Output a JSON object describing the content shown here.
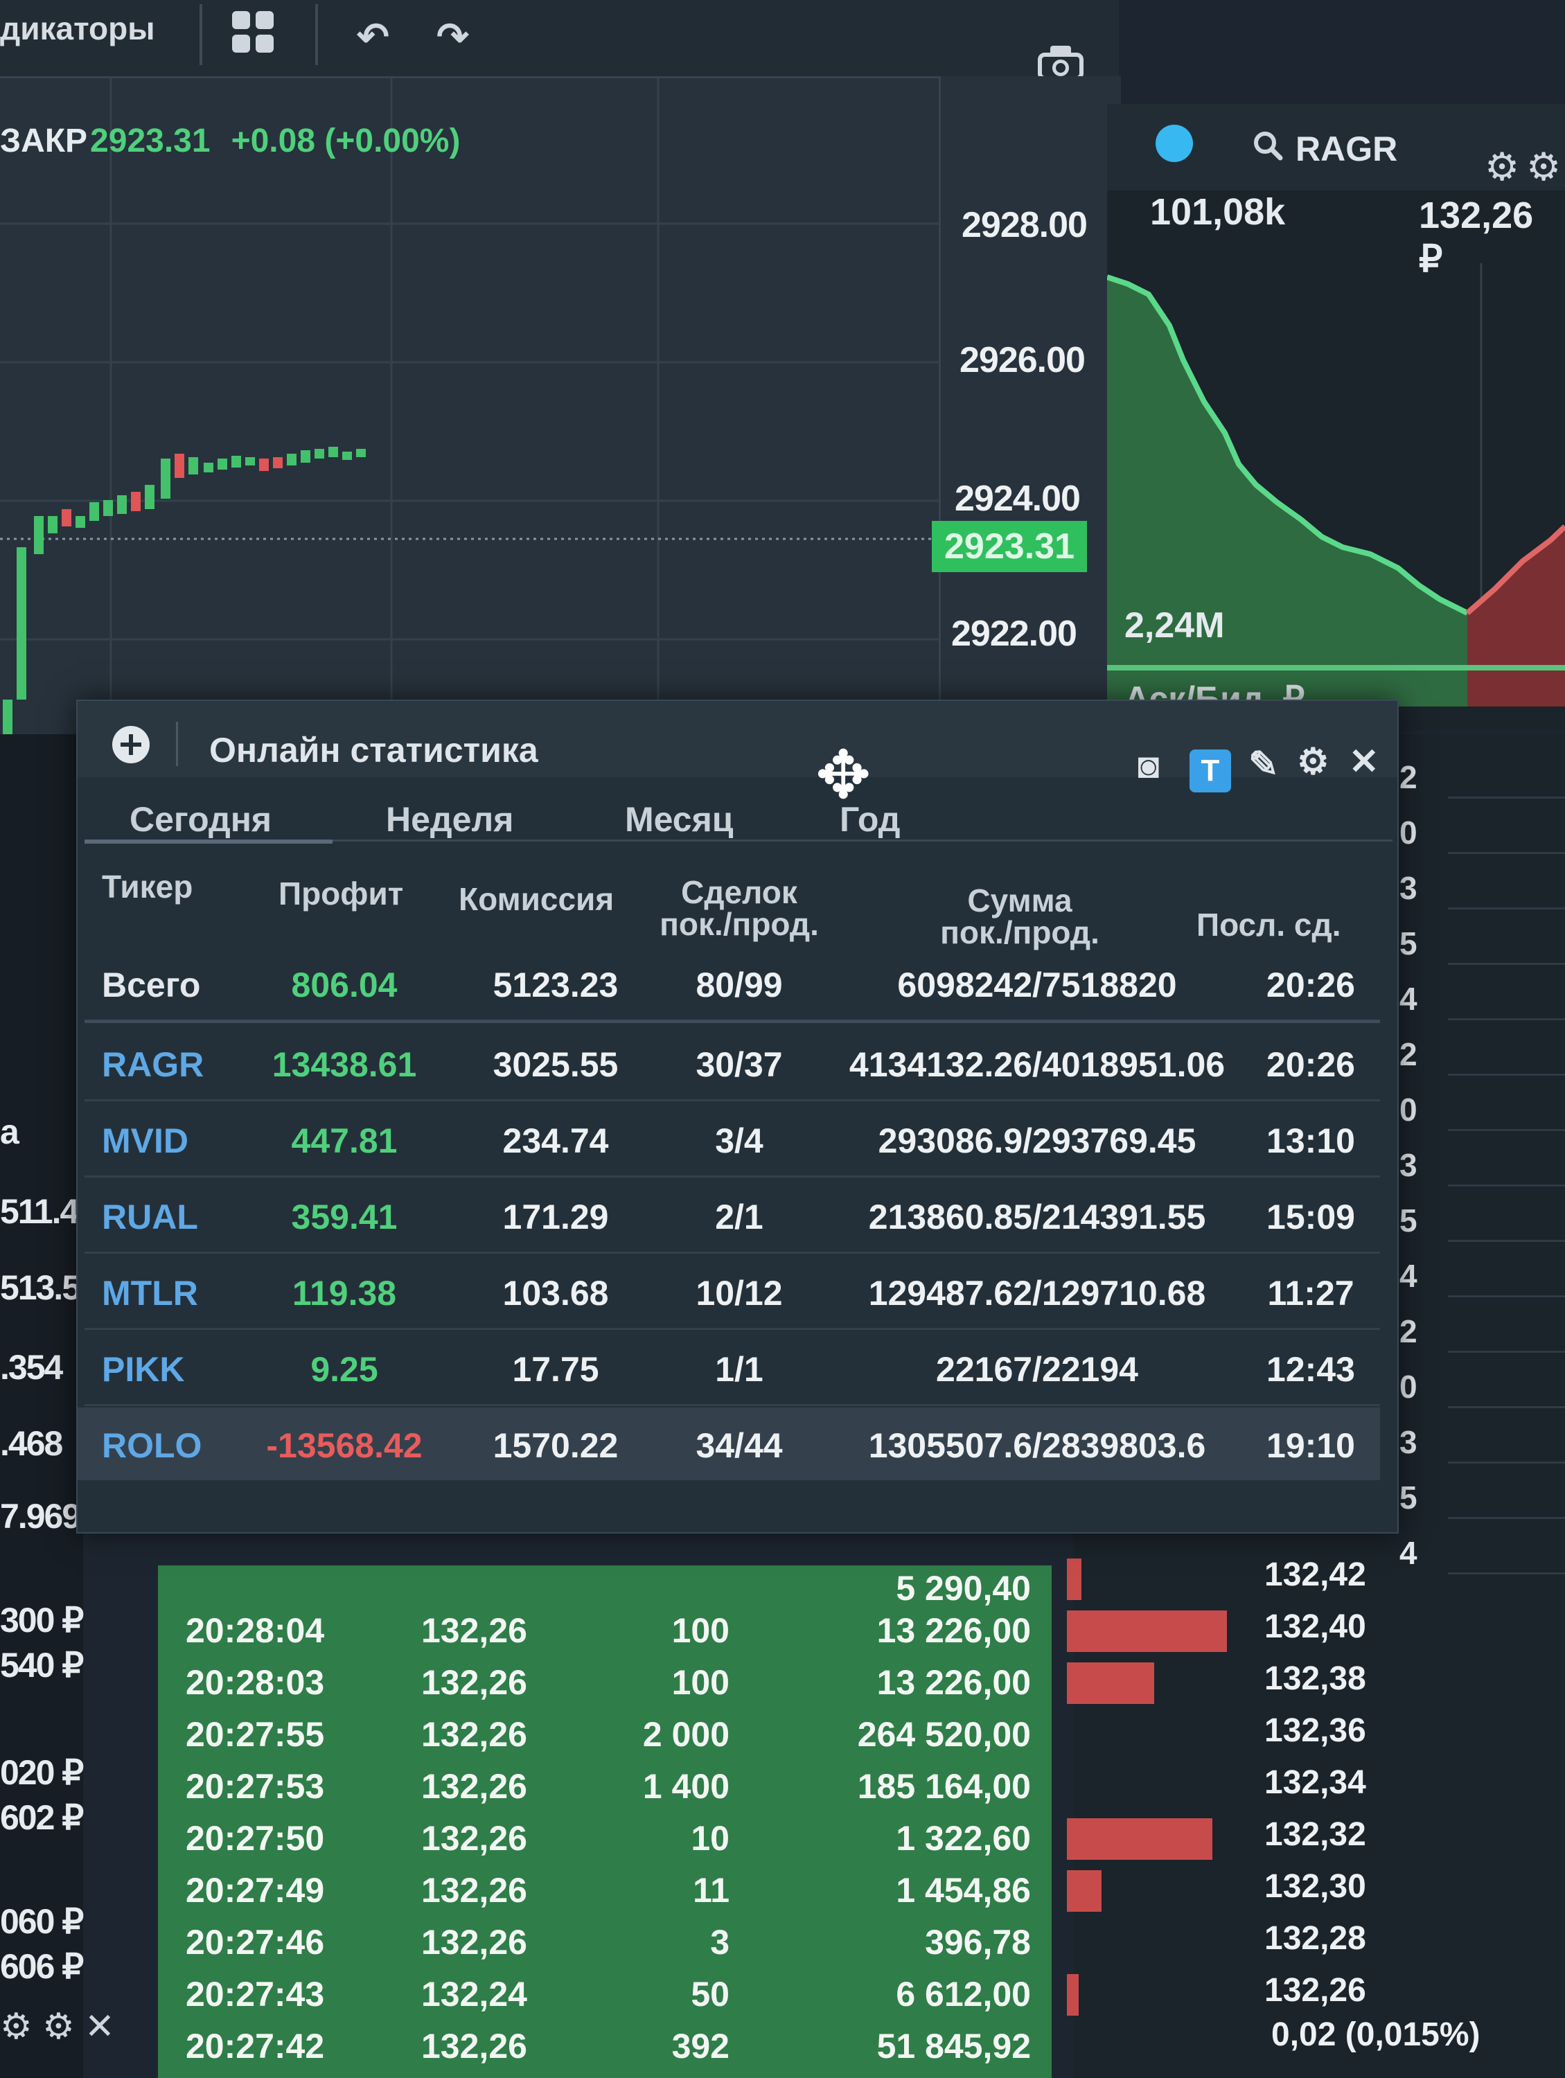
{
  "toolbar": {
    "indicators_label": "дикаторы"
  },
  "quote": {
    "ticker": "ЗАКР",
    "price": "2923.31",
    "change": "+0.08 (+0.00%)"
  },
  "price_axis": {
    "levels": [
      "2928.00",
      "2926.00",
      "2924.00",
      "2922.00"
    ],
    "current": "2923.31"
  },
  "depth": {
    "ticker": "RAGR",
    "volume": "101,08k",
    "price": "132,26 ₽",
    "bottom_volume": "2,24M",
    "caption": "Аск/Бид, ₽"
  },
  "stats": {
    "title": "Онлайн статистика",
    "tabs": [
      "Сегодня",
      "Неделя",
      "Месяц",
      "Год"
    ],
    "active_tab": "Сегодня",
    "columns": {
      "ticker": "Тикер",
      "profit": "Профит",
      "commission": "Комиссия",
      "deals_l1": "Сделок",
      "deals_l2": "пок./прод.",
      "sum_l1": "Сумма",
      "sum_l2": "пок./прод.",
      "last": "Посл. сд."
    },
    "total": {
      "label": "Всего",
      "profit": "806.04",
      "commission": "5123.23",
      "deals": "80/99",
      "sum": "6098242/7518820",
      "last": "20:26"
    },
    "rows": [
      {
        "ticker": "RAGR",
        "profit": "13438.61",
        "commission": "3025.55",
        "deals": "30/37",
        "sum": "4134132.26/4018951.06",
        "last": "20:26"
      },
      {
        "ticker": "MVID",
        "profit": "447.81",
        "commission": "234.74",
        "deals": "3/4",
        "sum": "293086.9/293769.45",
        "last": "13:10"
      },
      {
        "ticker": "RUAL",
        "profit": "359.41",
        "commission": "171.29",
        "deals": "2/1",
        "sum": "213860.85/214391.55",
        "last": "15:09"
      },
      {
        "ticker": "MTLR",
        "profit": "119.38",
        "commission": "103.68",
        "deals": "10/12",
        "sum": "129487.62/129710.68",
        "last": "11:27"
      },
      {
        "ticker": "PIKK",
        "profit": "9.25",
        "commission": "17.75",
        "deals": "1/1",
        "sum": "22167/22194",
        "last": "12:43"
      },
      {
        "ticker": "ROLO",
        "profit": "-13568.42",
        "commission": "1570.22",
        "deals": "34/44",
        "sum": "1305507.6/2839803.6",
        "last": "19:10"
      }
    ]
  },
  "left_sliver": {
    "values": [
      "а",
      "511.4",
      "513.5",
      ".354",
      ".468",
      "7.969"
    ],
    "rub_values": [
      "300 ₽",
      "540 ₽",
      "020 ₽",
      "602 ₽",
      "060 ₽",
      "606 ₽"
    ]
  },
  "tape": {
    "top_sum": "5 290,40",
    "trades": [
      {
        "time": "20:28:04",
        "price": "132,26",
        "qty": "100",
        "sum": "13 226,00"
      },
      {
        "time": "20:28:03",
        "price": "132,26",
        "qty": "100",
        "sum": "13 226,00"
      },
      {
        "time": "20:27:55",
        "price": "132,26",
        "qty": "2 000",
        "sum": "264 520,00"
      },
      {
        "time": "20:27:53",
        "price": "132,26",
        "qty": "1 400",
        "sum": "185 164,00"
      },
      {
        "time": "20:27:50",
        "price": "132,26",
        "qty": "10",
        "sum": "1 322,60"
      },
      {
        "time": "20:27:49",
        "price": "132,26",
        "qty": "11",
        "sum": "1 454,86"
      },
      {
        "time": "20:27:46",
        "price": "132,26",
        "qty": "3",
        "sum": "396,78"
      },
      {
        "time": "20:27:43",
        "price": "132,24",
        "qty": "50",
        "sum": "6 612,00"
      },
      {
        "time": "20:27:42",
        "price": "132,26",
        "qty": "392",
        "sum": "51 845,92"
      }
    ]
  },
  "order_book": {
    "ask_prices": [
      "132,42",
      "132,40",
      "132,38",
      "132,36",
      "132,34",
      "132,32",
      "132,30",
      "132,28",
      "132,26"
    ],
    "ask_volumes": [
      0.05,
      0.55,
      0.3,
      0,
      0,
      0.5,
      0.12,
      0,
      0.04
    ],
    "spread": "0,02 (0,015%)",
    "edge_digits": [
      "2",
      "0",
      "3",
      "5",
      "4",
      "2",
      "0",
      "3",
      "5",
      "4",
      "2",
      "0",
      "3",
      "5",
      "4"
    ]
  },
  "colors": {
    "up": "#4fd07c",
    "down": "#e85c5c",
    "ticker_link": "#5fa8e6",
    "tape_bg": "#2f7d48",
    "accent_blue": "#3aa0e8"
  }
}
